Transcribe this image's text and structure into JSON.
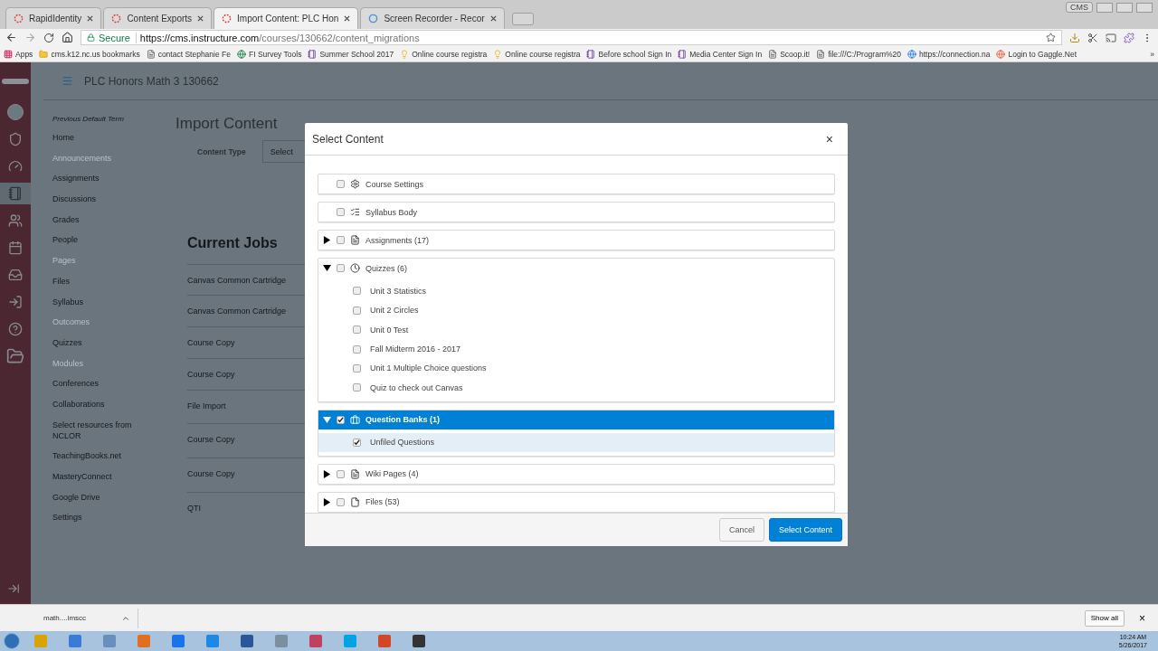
{
  "browser": {
    "tabs": [
      {
        "title": "RapidIdentity",
        "selected": false
      },
      {
        "title": "Content Exports",
        "selected": false
      },
      {
        "title": "Import Content: PLC Hon",
        "selected": true
      },
      {
        "title": "Screen Recorder - Recor",
        "selected": false
      }
    ],
    "profile": "CMS",
    "address": {
      "secure_label": "Secure",
      "url_host": "https://cms.instructure.com",
      "url_path": "/courses/130662/content_migrations"
    },
    "bookmarks": [
      {
        "label": "Apps",
        "kind": "apps"
      },
      {
        "label": "cms.k12.nc.us bookmarks",
        "kind": "folder"
      },
      {
        "label": "contact Stephanie Fe",
        "kind": "page"
      },
      {
        "label": "FI Survey Tools",
        "kind": "site"
      },
      {
        "label": "Summer School 2017",
        "kind": "form"
      },
      {
        "label": "Online course registra",
        "kind": "bulb"
      },
      {
        "label": "Online course registra",
        "kind": "bulb"
      },
      {
        "label": "Before school Sign In",
        "kind": "form"
      },
      {
        "label": "Media Center Sign In",
        "kind": "form"
      },
      {
        "label": "Scoop.it!",
        "kind": "page"
      },
      {
        "label": "file:///C:/Program%20",
        "kind": "page"
      },
      {
        "label": "https://connection.na",
        "kind": "globe"
      },
      {
        "label": "Login to Gaggle.Net",
        "kind": "gaggle"
      }
    ],
    "more_bookmarks": "»"
  },
  "page": {
    "course_title": "PLC Honors Math 3 130662",
    "term": "Previous Default Term",
    "nav_items": [
      {
        "label": "Home",
        "disabled": false
      },
      {
        "label": "Announcements",
        "disabled": true
      },
      {
        "label": "Assignments",
        "disabled": false
      },
      {
        "label": "Discussions",
        "disabled": false
      },
      {
        "label": "Grades",
        "disabled": false
      },
      {
        "label": "People",
        "disabled": false
      },
      {
        "label": "Pages",
        "disabled": true
      },
      {
        "label": "Files",
        "disabled": false
      },
      {
        "label": "Syllabus",
        "disabled": false
      },
      {
        "label": "Outcomes",
        "disabled": true
      },
      {
        "label": "Quizzes",
        "disabled": false
      },
      {
        "label": "Modules",
        "disabled": true
      },
      {
        "label": "Conferences",
        "disabled": false
      },
      {
        "label": "Collaborations",
        "disabled": false
      },
      {
        "label": "Select resources from NCLOR",
        "disabled": false
      },
      {
        "label": "TeachingBooks.net",
        "disabled": false
      },
      {
        "label": "MasteryConnect",
        "disabled": false
      },
      {
        "label": "Google Drive",
        "disabled": false
      },
      {
        "label": "Settings",
        "disabled": false
      }
    ],
    "heading": "Import Content",
    "content_type_label": "Content Type",
    "content_type_select": "Select",
    "jobs_heading": "Current Jobs",
    "jobs": [
      "Canvas Common Cartridge",
      "Canvas Common Cartridge",
      "Course Copy",
      "Course Copy",
      "File Import",
      "Course Copy",
      "Course Copy",
      "QTI"
    ]
  },
  "dialog": {
    "title": "Select Content",
    "close": "×",
    "items": [
      {
        "label": "Course Settings",
        "kind": "settings",
        "checked": false
      },
      {
        "label": "Syllabus Body",
        "kind": "syllabus",
        "checked": false
      },
      {
        "label": "Assignments (17)",
        "kind": "assignments",
        "checked": false,
        "expanded": false
      },
      {
        "label": "Quizzes (6)",
        "kind": "quizzes",
        "checked": false,
        "expanded": true,
        "children": [
          {
            "label": "Unit 3 Statistics",
            "checked": false
          },
          {
            "label": "Unit 2 Circles",
            "checked": false
          },
          {
            "label": "Unit 0 Test",
            "checked": false
          },
          {
            "label": "Fall Midterm 2016 - 2017",
            "checked": false
          },
          {
            "label": "Unit 1 Multiple Choice questions",
            "checked": false
          },
          {
            "label": "Quiz to check out Canvas",
            "checked": false
          }
        ]
      },
      {
        "label": "Question Banks (1)",
        "kind": "banks",
        "checked": true,
        "expanded": true,
        "children": [
          {
            "label": "Unfiled Questions",
            "checked": true
          }
        ]
      },
      {
        "label": "Wiki Pages (4)",
        "kind": "wiki",
        "checked": false,
        "expanded": false
      },
      {
        "label": "Files (53)",
        "kind": "files",
        "checked": false,
        "expanded": false
      }
    ],
    "cancel": "Cancel",
    "submit": "Select Content"
  },
  "downloads": {
    "file": "math....imscc",
    "show_all": "Show all",
    "close": "×"
  },
  "taskbar": {
    "time": "10:24 AM",
    "date": "5/26/2017"
  }
}
